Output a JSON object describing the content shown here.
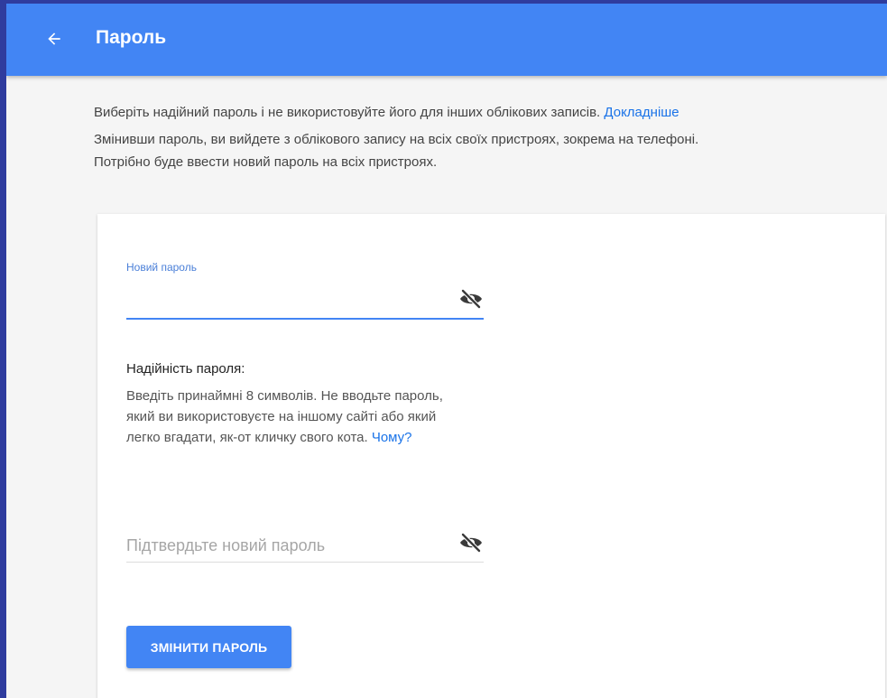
{
  "header": {
    "title": "Пароль",
    "back_icon": "arrow-back-icon",
    "color": "#4285f4"
  },
  "intro": {
    "line1": "Виберіть надійний пароль і не використовуйте його для інших облікових записів.",
    "learn_more": "Докладніше",
    "line2": "Змінивши пароль, ви вийдете з облікового запису на всіх своїх пристроях, зокрема на телефоні.",
    "line3": "Потрібно буде ввести новий пароль на всіх пристроях."
  },
  "form": {
    "new_password": {
      "label": "Новий пароль",
      "value": "",
      "toggle_icon": "eye-off-icon"
    },
    "strength": {
      "title": "Надійність пароля:",
      "text": "Введіть принаймні 8 символів. Не вводьте пароль, який ви використовуєте на іншому сайті або який легко вгадати, як-от кличку свого кота.",
      "why_link": "Чому?"
    },
    "confirm_password": {
      "placeholder": "Підтвердьте новий пароль",
      "value": "",
      "toggle_icon": "eye-off-icon"
    },
    "submit_label": "ЗМІНИТИ ПАРОЛЬ"
  },
  "colors": {
    "accent": "#4285f4",
    "link": "#1a73e8"
  }
}
